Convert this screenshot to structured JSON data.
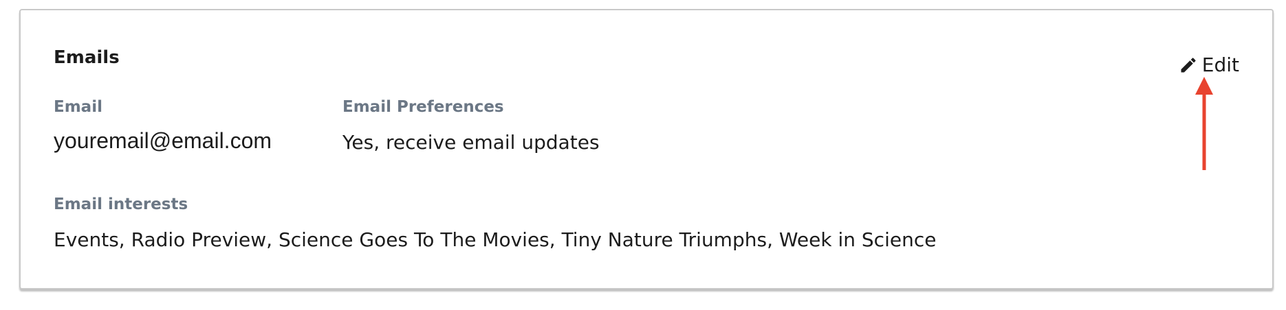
{
  "section": {
    "title": "Emails",
    "edit_label": "Edit"
  },
  "fields": {
    "email": {
      "label": "Email",
      "value": "youremail@email.com"
    },
    "preferences": {
      "label": "Email Preferences",
      "value": "Yes, receive email updates"
    },
    "interests": {
      "label": "Email interests",
      "value": "Events, Radio Preview, Science Goes To The Movies, Tiny Nature Triumphs, Week in Science"
    }
  },
  "colors": {
    "annotation_arrow": "#e8432f",
    "label": "#6b7785",
    "border": "#c9c9c9"
  },
  "icons": {
    "edit": "pencil-icon",
    "annotation": "arrow-up-icon"
  }
}
